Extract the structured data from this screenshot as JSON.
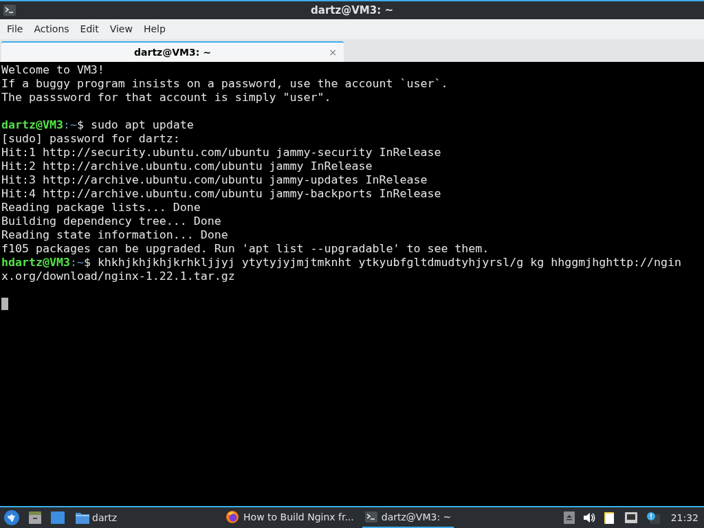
{
  "window": {
    "title": "dartz@VM3: ~"
  },
  "menu": [
    "File",
    "Actions",
    "Edit",
    "View",
    "Help"
  ],
  "tabs": [
    {
      "label": "dartz@VM3: ~",
      "selected": true,
      "close": "×"
    }
  ],
  "terminal": {
    "lines": [
      {
        "kind": "text",
        "text": "Welcome to VM3!"
      },
      {
        "kind": "text",
        "text": "If a buggy program insists on a password, use the account `user`."
      },
      {
        "kind": "text",
        "text": "The passsword for that account is simply \"user\"."
      },
      {
        "kind": "blank"
      },
      {
        "kind": "prompt",
        "user_host": "dartz@VM3",
        "path": ":~",
        "symbol": "$",
        "command": " sudo apt update"
      },
      {
        "kind": "text",
        "text": "[sudo] password for dartz:"
      },
      {
        "kind": "text",
        "text": "Hit:1 http://security.ubuntu.com/ubuntu jammy-security InRelease"
      },
      {
        "kind": "text",
        "text": "Hit:2 http://archive.ubuntu.com/ubuntu jammy InRelease"
      },
      {
        "kind": "text",
        "text": "Hit:3 http://archive.ubuntu.com/ubuntu jammy-updates InRelease"
      },
      {
        "kind": "text",
        "text": "Hit:4 http://archive.ubuntu.com/ubuntu jammy-backports InRelease"
      },
      {
        "kind": "text",
        "text": "Reading package lists... Done"
      },
      {
        "kind": "text",
        "text": "Building dependency tree... Done"
      },
      {
        "kind": "text",
        "text": "Reading state information... Done"
      },
      {
        "kind": "text",
        "text": "f105 packages can be upgraded. Run 'apt list --upgradable' to see them."
      },
      {
        "kind": "prompt",
        "user_host": "hdartz@VM3",
        "path": ":~",
        "symbol": "$",
        "command": " khkhjkhjkhjkrhkljjyj ytytyjyjmjtmknht ytkyubfgltdmudtyhjyrsl/g kg hhggmjhghttp://nginx.org/download/nginx-1.22.1.tar.gz"
      },
      {
        "kind": "blank"
      },
      {
        "kind": "cursor"
      }
    ]
  },
  "taskbar": {
    "launchers": [
      {
        "kind": "start"
      },
      {
        "kind": "files"
      },
      {
        "kind": "desktop"
      },
      {
        "kind": "folder",
        "label": "dartz"
      }
    ],
    "tasks": [
      {
        "kind": "browser",
        "label": "How to Build Nginx fr...",
        "selected": false
      },
      {
        "kind": "terminal",
        "label": "dartz@VM3: ~",
        "selected": true
      }
    ],
    "clock": "21:32"
  }
}
